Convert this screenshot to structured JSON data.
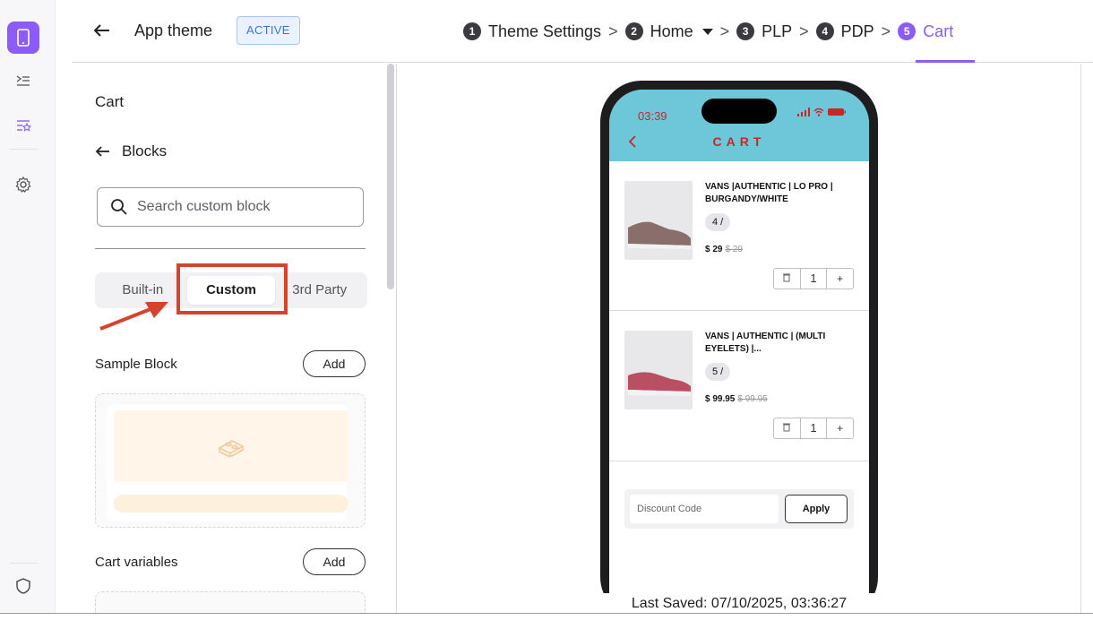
{
  "header": {
    "title": "App theme",
    "status_badge": "ACTIVE",
    "steps": [
      {
        "num": "1",
        "label": "Theme Settings"
      },
      {
        "num": "2",
        "label": "Home"
      },
      {
        "num": "3",
        "label": "PLP"
      },
      {
        "num": "4",
        "label": "PDP"
      },
      {
        "num": "5",
        "label": "Cart"
      }
    ],
    "current_step": 5,
    "separator": ">"
  },
  "panel": {
    "title": "Cart",
    "subtitle": "Blocks",
    "search_placeholder": "Search custom block",
    "tabs": [
      "Built-in",
      "Custom",
      "3rd Party"
    ],
    "selected_tab": "Custom",
    "blocks": [
      {
        "label": "Sample Block",
        "add_label": "Add"
      },
      {
        "label": "Cart variables",
        "add_label": "Add"
      }
    ]
  },
  "preview": {
    "status_time": "03:39",
    "screen_title": "CART",
    "items": [
      {
        "name": "VANS |AUTHENTIC | LO PRO | BURGANDY/WHITE",
        "variant": "4 /",
        "price": "$ 29",
        "compare_price": "$ 29",
        "qty": "1"
      },
      {
        "name": "VANS | AUTHENTIC | (MULTI EYELETS) |...",
        "variant": "5 /",
        "price": "$ 99.95",
        "compare_price": "$ 99.95",
        "qty": "1"
      }
    ],
    "discount_placeholder": "Discount Code",
    "apply_label": "Apply"
  },
  "footer": {
    "last_saved_label": "Last Saved:",
    "last_saved_value": "07/10/2025, 03:36:27"
  },
  "colors": {
    "accent": "#8b5cf6",
    "phone_header": "#6ec6d9",
    "cart_red": "#c62828",
    "annotation_red": "#d5422e"
  }
}
